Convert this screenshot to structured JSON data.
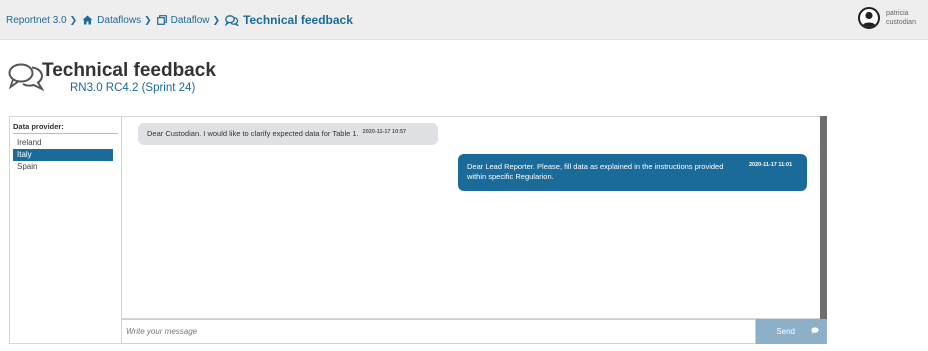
{
  "breadcrumb": {
    "items": [
      {
        "label": "Reportnet 3.0",
        "icon": "none"
      },
      {
        "label": "Dataflows",
        "icon": "home-icon"
      },
      {
        "label": "Dataflow",
        "icon": "clone-icon"
      }
    ],
    "current": {
      "label": "Technical feedback",
      "icon": "comments-icon"
    }
  },
  "user": {
    "name": "patricia custodian"
  },
  "header": {
    "title": "Technical feedback",
    "subtitle": "RN3.0 RC4.2 (Sprint 24)"
  },
  "providers": {
    "label": "Data provider:",
    "items": [
      {
        "name": "Ireland",
        "selected": false
      },
      {
        "name": "Italy",
        "selected": true
      },
      {
        "name": "Spain",
        "selected": false
      }
    ]
  },
  "messages": [
    {
      "direction": "incoming",
      "text": "Dear Custodian. I would like to clarify expected data for Table 1.",
      "timestamp": "2020-11-17 10:57"
    },
    {
      "direction": "outgoing",
      "text": "Dear Lead Reporter. Please, fill data as explained in the instructions provided within specific Regularion.",
      "timestamp": "2020-11-17 11:01"
    }
  ],
  "composer": {
    "placeholder": "Write your message",
    "value": "",
    "send_label": "Send"
  },
  "colors": {
    "accent": "#1b6b9a",
    "send_button": "#8bb0c8",
    "incoming_bubble": "#dfe1e4",
    "topbar": "#eeeeee"
  }
}
